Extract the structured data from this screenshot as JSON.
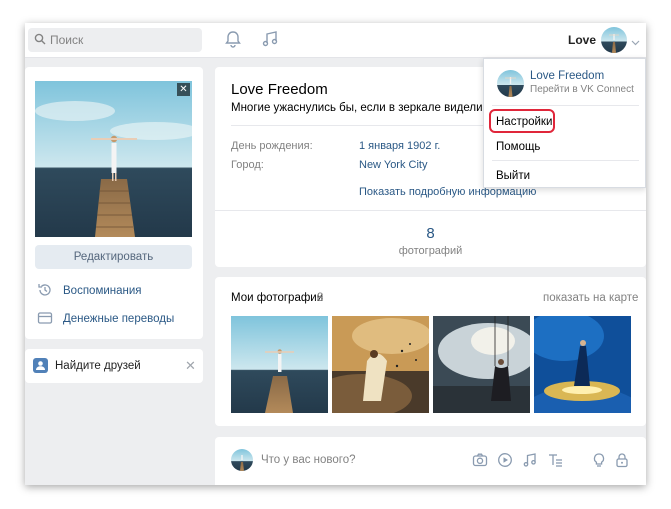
{
  "topbar": {
    "search_placeholder": "Поиск",
    "username": "Love",
    "icons": [
      "search-icon",
      "bell-icon",
      "music-icon",
      "chevron-down-icon"
    ]
  },
  "left": {
    "edit_label": "Редактировать",
    "menu": [
      {
        "label": "Воспоминания",
        "icon": "memories-icon"
      },
      {
        "label": "Денежные переводы",
        "icon": "money-transfer-icon"
      }
    ],
    "friends_label": "Найдите друзей"
  },
  "profile": {
    "name": "Love Freedom",
    "status": "Многие ужаснулись бы, если в зеркале видели не л",
    "birthday_label": "День рождения:",
    "birthday_value": "1 января 1902 г.",
    "city_label": "Город:",
    "city_value": "New York City",
    "more_info": "Показать подробную информацию",
    "photos_count": "8",
    "photos_count_label": "фотографий"
  },
  "photos": {
    "title": "Мои фотографии",
    "count": "8",
    "map_link": "показать на карте"
  },
  "composer": {
    "placeholder": "Что у вас нового?",
    "icons": [
      "camera-icon",
      "video-icon",
      "music-icon",
      "text-icon",
      "bulb-icon",
      "lock-icon"
    ]
  },
  "dropdown": {
    "name": "Love Freedom",
    "subtitle": "Перейти в VK Connect",
    "items": [
      "Настройки",
      "Помощь",
      "Выйти"
    ],
    "highlight_color": "#e0263a"
  },
  "colors": {
    "link": "#2a5885",
    "muted": "#828282",
    "background": "#edeef0",
    "accent": "#5181b8"
  }
}
